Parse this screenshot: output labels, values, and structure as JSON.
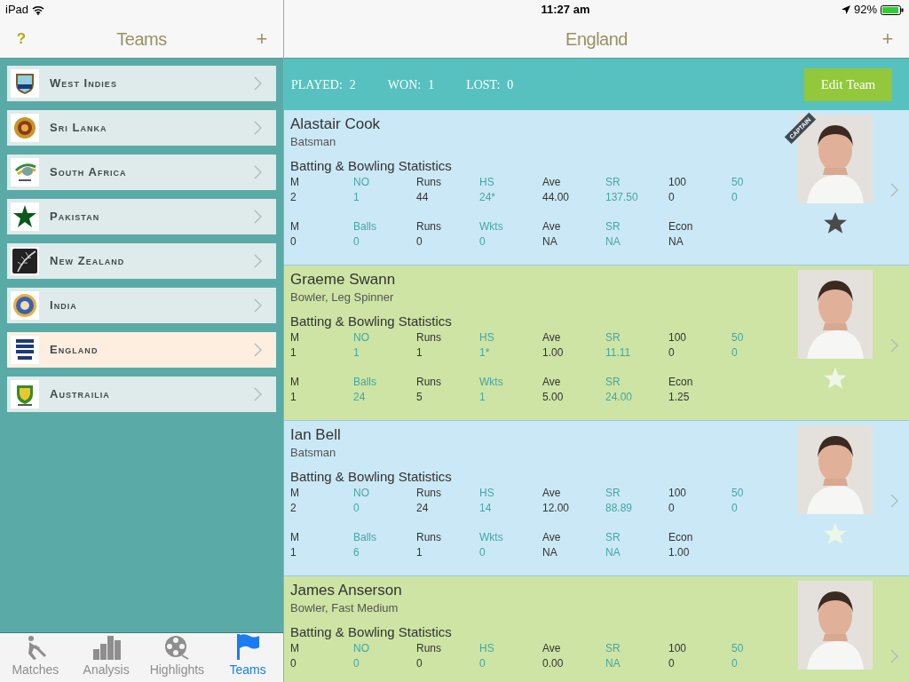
{
  "status_bar": {
    "device": "iPad",
    "time": "11:27 am",
    "battery": "92%"
  },
  "sidebar": {
    "help": "?",
    "title": "Teams",
    "add": "+",
    "teams": [
      {
        "name": "West Indies",
        "selected": false
      },
      {
        "name": "Sri Lanka",
        "selected": false
      },
      {
        "name": "South Africa",
        "selected": false
      },
      {
        "name": "Pakistan",
        "selected": false
      },
      {
        "name": "New Zealand",
        "selected": false
      },
      {
        "name": "India",
        "selected": false
      },
      {
        "name": "England",
        "selected": true
      },
      {
        "name": "Austrailia",
        "selected": false
      }
    ]
  },
  "main": {
    "title": "England",
    "add": "+",
    "summary": [
      {
        "label": "PLAYED:",
        "value": "2"
      },
      {
        "label": "WON:",
        "value": "1"
      },
      {
        "label": "LOST:",
        "value": "0"
      }
    ],
    "edit_button": "Edit Team",
    "players": [
      {
        "name": "Alastair Cook",
        "role": "Batsman",
        "captain": true,
        "captain_label": "CAPTAIN",
        "favorite": true,
        "stats_title": "Batting & Bowling Statistics",
        "batting": {
          "headers": [
            "M",
            "NO",
            "Runs",
            "HS",
            "Ave",
            "SR",
            "100",
            "50"
          ],
          "values": [
            "2",
            "1",
            "44",
            "24*",
            "44.00",
            "137.50",
            "0",
            "0"
          ]
        },
        "bowling": {
          "headers": [
            "M",
            "Balls",
            "Runs",
            "Wkts",
            "Ave",
            "SR",
            "Econ"
          ],
          "values": [
            "0",
            "0",
            "0",
            "0",
            "NA",
            "NA",
            "NA"
          ]
        }
      },
      {
        "name": "Graeme Swann",
        "role": "Bowler, Leg Spinner",
        "captain": false,
        "favorite": false,
        "stats_title": "Batting & Bowling Statistics",
        "batting": {
          "headers": [
            "M",
            "NO",
            "Runs",
            "HS",
            "Ave",
            "SR",
            "100",
            "50"
          ],
          "values": [
            "1",
            "1",
            "1",
            "1*",
            "1.00",
            "11.11",
            "0",
            "0"
          ]
        },
        "bowling": {
          "headers": [
            "M",
            "Balls",
            "Runs",
            "Wkts",
            "Ave",
            "SR",
            "Econ"
          ],
          "values": [
            "1",
            "24",
            "5",
            "1",
            "5.00",
            "24.00",
            "1.25"
          ]
        }
      },
      {
        "name": "Ian Bell",
        "role": "Batsman",
        "captain": false,
        "favorite": false,
        "stats_title": "Batting & Bowling Statistics",
        "batting": {
          "headers": [
            "M",
            "NO",
            "Runs",
            "HS",
            "Ave",
            "SR",
            "100",
            "50"
          ],
          "values": [
            "2",
            "0",
            "24",
            "14",
            "12.00",
            "88.89",
            "0",
            "0"
          ]
        },
        "bowling": {
          "headers": [
            "M",
            "Balls",
            "Runs",
            "Wkts",
            "Ave",
            "SR",
            "Econ"
          ],
          "values": [
            "1",
            "6",
            "1",
            "0",
            "NA",
            "NA",
            "1.00"
          ]
        }
      },
      {
        "name": "James Anserson",
        "role": "Bowler, Fast Medium",
        "captain": false,
        "stats_title": "Batting & Bowling Statistics",
        "batting": {
          "headers": [
            "M",
            "NO",
            "Runs",
            "HS",
            "Ave",
            "SR",
            "100",
            "50"
          ],
          "values": [
            "0",
            "0",
            "0",
            "0",
            "0.00",
            "NA",
            "0",
            "0"
          ]
        }
      }
    ]
  },
  "tab_bar": [
    {
      "label": "Matches",
      "kind": "batsman",
      "selected": false
    },
    {
      "label": "Analysis",
      "kind": "chart",
      "selected": false
    },
    {
      "label": "Highlights",
      "kind": "film",
      "selected": false
    },
    {
      "label": "Teams",
      "kind": "flag",
      "selected": true
    }
  ]
}
